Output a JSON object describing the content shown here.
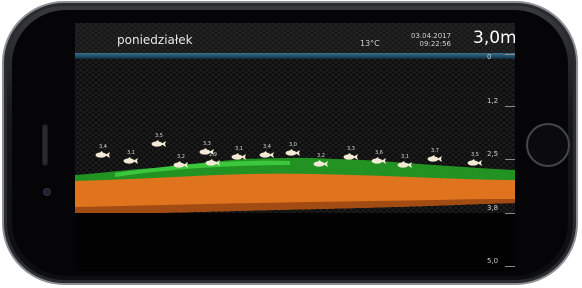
{
  "hud": {
    "day": "poniedziałek",
    "temperature": "13°C",
    "date": "03.04.2017",
    "time": "09:22:56",
    "depth": "3,0m"
  },
  "depth_scale": {
    "labels": [
      "0",
      "1,2",
      "2,5",
      "3,8",
      "5,0"
    ]
  },
  "fish": [
    {
      "label": "3,4"
    },
    {
      "label": "3,1"
    },
    {
      "label": "3,5"
    },
    {
      "label": "3,2"
    },
    {
      "label": "3,3"
    },
    {
      "label": "2,9"
    },
    {
      "label": "3,1"
    },
    {
      "label": "3,4"
    },
    {
      "label": "3,0"
    },
    {
      "label": "3,2"
    },
    {
      "label": "3,3"
    },
    {
      "label": "3,6"
    },
    {
      "label": "3,1"
    },
    {
      "label": "3,7"
    },
    {
      "label": "3,5"
    }
  ],
  "colors": {
    "bottom": "#e0731e",
    "vegetation": "#2fbf2f",
    "surface": "#3b6f8e",
    "fish": "#f3ead6"
  }
}
